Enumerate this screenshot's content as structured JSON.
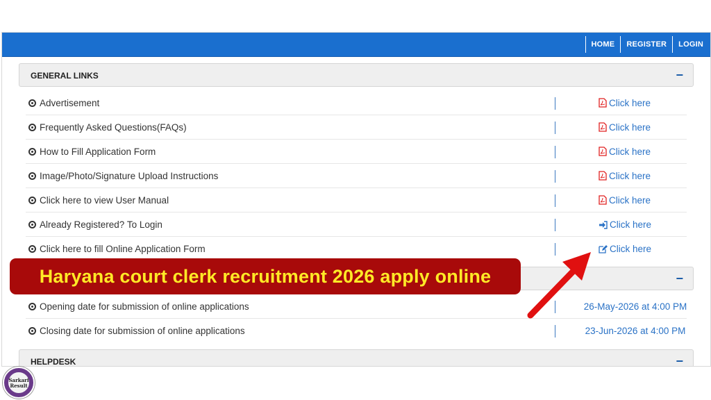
{
  "nav": {
    "home": "HOME",
    "register": "REGISTER",
    "login": "LOGIN"
  },
  "general_links": {
    "title": "GENERAL LINKS",
    "toggle": "−",
    "rows": [
      {
        "label": "Advertisement",
        "link": "Click here",
        "icon": "pdf-icon"
      },
      {
        "label": "Frequently Asked Questions(FAQs)",
        "link": "Click here",
        "icon": "pdf-icon"
      },
      {
        "label": "How to Fill Application Form",
        "link": "Click here",
        "icon": "pdf-icon"
      },
      {
        "label": "Image/Photo/Signature Upload Instructions",
        "link": "Click here",
        "icon": "pdf-icon"
      },
      {
        "label": "Click here to view User Manual",
        "link": "Click here",
        "icon": "pdf-icon"
      },
      {
        "label": "Already Registered? To Login",
        "link": "Click here",
        "icon": "sign-in-icon"
      },
      {
        "label": "Click here to fill Online Application Form",
        "link": "Click here",
        "icon": "edit-icon"
      }
    ]
  },
  "dates": {
    "toggle": "−",
    "rows": [
      {
        "label": "Opening date for submission of online applications",
        "value": "26-May-2026 at 4:00 PM"
      },
      {
        "label": "Closing date for submission of online applications",
        "value": "23-Jun-2026 at 4:00 PM"
      }
    ]
  },
  "helpdesk": {
    "title": "HELPDESK",
    "toggle": "−"
  },
  "banner": {
    "text": "Haryana court clerk recruitment 2026 apply online"
  },
  "logo": {
    "line1": "Sarkari",
    "line2": "Result"
  },
  "colors": {
    "topbar": "#1a6fcf",
    "link": "#2a72c6",
    "pdf": "#e02020",
    "banner_bg": "#a80a0a",
    "banner_text": "#ffe926",
    "arrow": "#e01010"
  }
}
